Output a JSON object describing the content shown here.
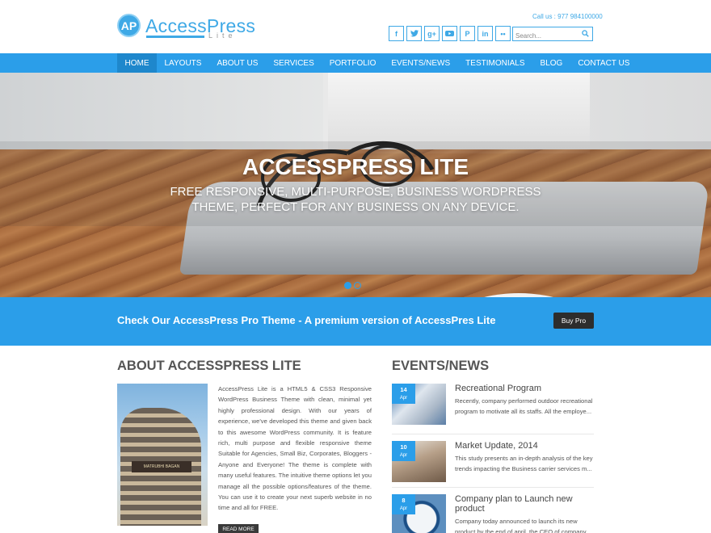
{
  "header": {
    "logo_badge": "AP",
    "logo_title": "AccessPress",
    "logo_sub": "Lite",
    "call": "Call us : 977 984100000",
    "social": [
      {
        "icon": "facebook-icon",
        "glyph": "f"
      },
      {
        "icon": "twitter-icon",
        "glyph": "t"
      },
      {
        "icon": "google-plus-icon",
        "glyph": "g+"
      },
      {
        "icon": "youtube-icon",
        "glyph": "▶"
      },
      {
        "icon": "pinterest-icon",
        "glyph": "P"
      },
      {
        "icon": "linkedin-icon",
        "glyph": "in"
      },
      {
        "icon": "flickr-icon",
        "glyph": "••"
      }
    ],
    "search_placeholder": "Search..."
  },
  "nav": {
    "items": [
      "HOME",
      "LAYOUTS",
      "ABOUT US",
      "SERVICES",
      "PORTFOLIO",
      "EVENTS/NEWS",
      "TESTIMONIALS",
      "BLOG",
      "CONTACT US"
    ],
    "active": "HOME"
  },
  "hero": {
    "title": "ACCESSPRESS LITE",
    "subtitle": "FREE RESPONSIVE, MULTI-PURPOSE, BUSINESS WORDPRESS THEME, PERFECT FOR ANY BUSINESS ON ANY DEVICE.",
    "slides": 2,
    "active_slide": 1
  },
  "promo": {
    "text": "Check Our AccessPress Pro Theme - A premium version of AccessPres Lite",
    "button": "Buy Pro"
  },
  "about": {
    "heading": "ABOUT ACCESSPRESS LITE",
    "image_sign": "MATRUBHI BAGAN",
    "text": "AccessPress Lite is a HTML5 & CSS3 Responsive WordPress Business Theme with clean, minimal yet highly professional design. With our years of experience, we've developed this theme and given back to this awesome WordPress community. It is feature rich, multi purpose and flexible responsive theme Suitable for Agencies, Small Biz, Corporates, Bloggers - Anyone and Everyone! The theme is complete with many useful features. The intuitive theme options let you manage all the possible options/features of the theme. You can use it to create your next superb website in no time and all for FREE.",
    "read_more": "READ MORE"
  },
  "events": {
    "heading": "EVENTS/NEWS",
    "items": [
      {
        "day": "14",
        "month": "Apr",
        "title": "Recreational Program",
        "desc": "Recently, company performed outdoor recreational program to motivate all its staffs. All the employe..."
      },
      {
        "day": "10",
        "month": "Apr",
        "title": "Market Update, 2014",
        "desc": "This study presents an in-depth analysis of the key trends impacting the Business carrier services m..."
      },
      {
        "day": "8",
        "month": "Apr",
        "title": "Company plan to Launch new product",
        "desc": "Company today announced to launch its new product by the end of april, the CEO of company"
      }
    ]
  },
  "colors": {
    "accent": "#2b9ee9",
    "nav_active": "#1e87cc",
    "dark_button": "#2d2d2d"
  }
}
